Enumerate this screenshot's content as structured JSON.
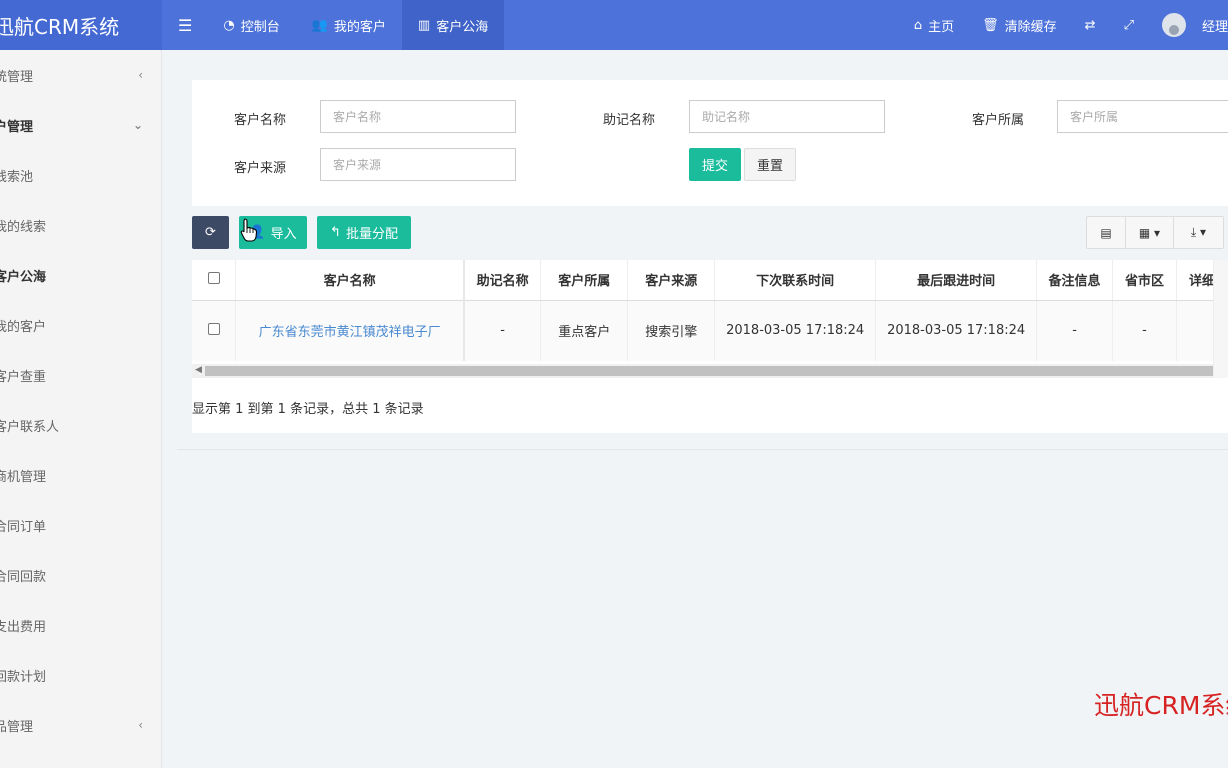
{
  "app": {
    "title": "迅航CRM系统"
  },
  "topnav": {
    "toggle_icon": "menu-icon",
    "items": [
      {
        "label": "控制台",
        "icon": "dashboard-icon"
      },
      {
        "label": "我的客户",
        "icon": "users-icon"
      },
      {
        "label": "客户公海",
        "icon": "map-icon",
        "active": true
      }
    ],
    "right": [
      {
        "label": "主页",
        "icon": "home-icon"
      },
      {
        "label": "清除缓存",
        "icon": "trash-icon"
      },
      {
        "label": "",
        "icon": "translate-icon"
      },
      {
        "label": "",
        "icon": "fullscreen-icon"
      }
    ],
    "user": {
      "name": "经理"
    }
  },
  "sidebar": {
    "items": [
      {
        "label": "统管理",
        "chevron": "‹",
        "bold": false
      },
      {
        "label": "户管理",
        "chevron": "⌄",
        "bold": true
      },
      {
        "label": "线索池",
        "chevron": "",
        "bold": false
      },
      {
        "label": "我的线索",
        "chevron": "",
        "bold": false
      },
      {
        "label": "客户公海",
        "chevron": "",
        "bold": true
      },
      {
        "label": "我的客户",
        "chevron": "",
        "bold": false
      },
      {
        "label": "客户查重",
        "chevron": "",
        "bold": false
      },
      {
        "label": "客户联系人",
        "chevron": "",
        "bold": false
      },
      {
        "label": "商机管理",
        "chevron": "",
        "bold": false
      },
      {
        "label": "合同订单",
        "chevron": "",
        "bold": false
      },
      {
        "label": "合同回款",
        "chevron": "",
        "bold": false
      },
      {
        "label": "支出费用",
        "chevron": "",
        "bold": false
      },
      {
        "label": "回款计划",
        "chevron": "",
        "bold": false
      },
      {
        "label": "品管理",
        "chevron": "‹",
        "bold": false
      }
    ]
  },
  "search": {
    "customer_name": {
      "label": "客户名称",
      "placeholder": "客户名称"
    },
    "mnemonic_name": {
      "label": "助记名称",
      "placeholder": "助记名称"
    },
    "customer_owner": {
      "label": "客户所属",
      "placeholder": "客户所属"
    },
    "customer_source": {
      "label": "客户来源",
      "placeholder": "客户来源"
    },
    "submit_label": "提交",
    "reset_label": "重置"
  },
  "toolbar": {
    "refresh_icon": "refresh-icon",
    "import_label": "导入",
    "batch_assign_label": "批量分配"
  },
  "table": {
    "columns": [
      "客户名称",
      "助记名称",
      "客户所属",
      "客户来源",
      "下次联系时间",
      "最后跟进时间",
      "备注信息",
      "省市区",
      "详细"
    ],
    "rows": [
      [
        "广东省东莞市黄江镇茂祥电子厂",
        "-",
        "重点客户",
        "搜索引擎",
        "2018-03-05 17:18:24",
        "2018-03-05 17:18:24",
        "-",
        "-",
        ""
      ]
    ],
    "summary": "显示第 1 到第 1 条记录，总共 1 条记录"
  },
  "watermark": "迅航CRM系统",
  "colors": {
    "topbar": "#4d72d9",
    "accent": "#1abc9c",
    "dark_button": "#3d4a66",
    "link": "#4a8ad1",
    "watermark": "#d62222"
  }
}
